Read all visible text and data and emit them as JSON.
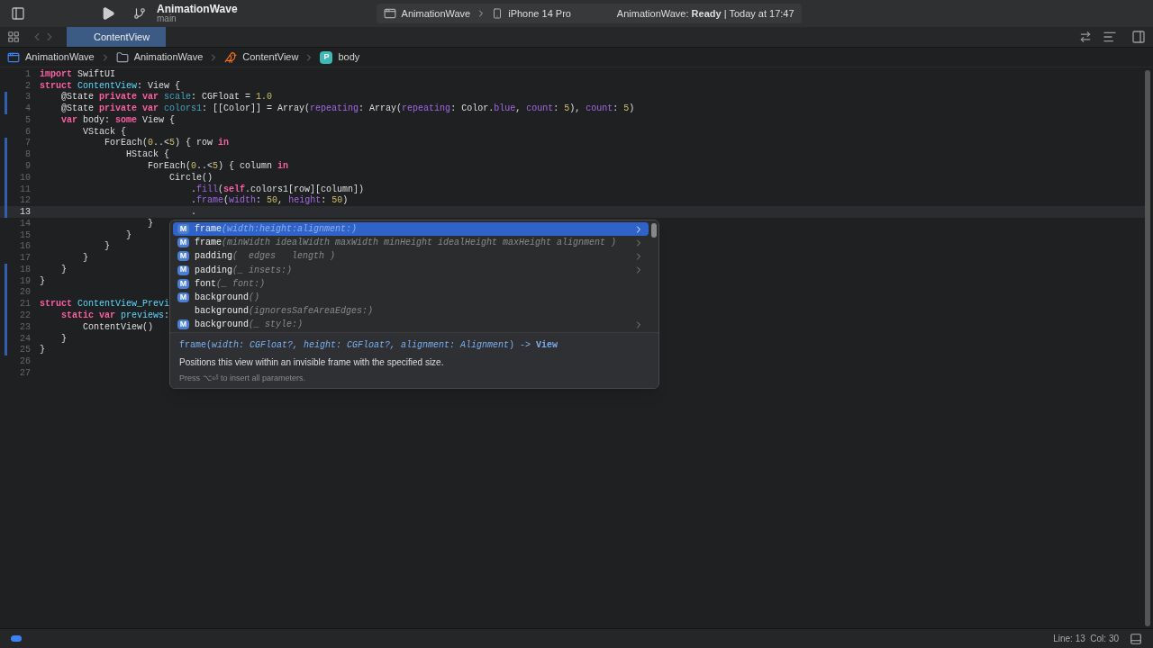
{
  "toolbar": {
    "project": "AnimationWave",
    "branch": "main",
    "scheme": "AnimationWave",
    "device": "iPhone 14 Pro",
    "status": "AnimationWave: **Ready** | Today at 17:47"
  },
  "tabs": [
    {
      "label": "ContentView",
      "selected": true
    }
  ],
  "breadcrumbs": [
    {
      "label": "AnimationWave",
      "kind": "app"
    },
    {
      "label": "AnimationWave",
      "kind": "folder"
    },
    {
      "label": "ContentView",
      "kind": "swift"
    },
    {
      "label": "body",
      "kind": "property",
      "badge": "P"
    }
  ],
  "editor": {
    "lines": [
      {
        "number": "1",
        "changed": false,
        "current": false,
        "tokens": [
          {
            "text": "import",
            "kind": "keyword"
          },
          {
            "text": " SwiftUI",
            "kind": "plain"
          }
        ]
      },
      {
        "number": "2",
        "changed": false,
        "current": false,
        "tokens": [
          {
            "text": "struct",
            "kind": "keyword"
          },
          {
            "text": " ContentView",
            "kind": "declaration"
          },
          {
            "text": ": View {",
            "kind": "plain"
          }
        ]
      },
      {
        "number": "3",
        "changed": true,
        "current": false,
        "tokens": [
          {
            "text": "    @State ",
            "kind": "plain"
          },
          {
            "text": "private var",
            "kind": "keyword"
          },
          {
            "text": " scale",
            "kind": "variable"
          },
          {
            "text": ": CGFloat = ",
            "kind": "plain"
          },
          {
            "text": "1.0",
            "kind": "number"
          }
        ]
      },
      {
        "number": "4",
        "changed": true,
        "current": false,
        "tokens": [
          {
            "text": "    @State ",
            "kind": "plain"
          },
          {
            "text": "private var",
            "kind": "keyword"
          },
          {
            "text": " colors1",
            "kind": "variable"
          },
          {
            "text": ": [[Color]] = Array(",
            "kind": "plain"
          },
          {
            "text": "repeating",
            "kind": "parameter"
          },
          {
            "text": ": Array(",
            "kind": "plain"
          },
          {
            "text": "repeating",
            "kind": "parameter"
          },
          {
            "text": ": Color.",
            "kind": "plain"
          },
          {
            "text": "blue",
            "kind": "method"
          },
          {
            "text": ", ",
            "kind": "plain"
          },
          {
            "text": "count",
            "kind": "parameter"
          },
          {
            "text": ": ",
            "kind": "plain"
          },
          {
            "text": "5",
            "kind": "number"
          },
          {
            "text": "), ",
            "kind": "plain"
          },
          {
            "text": "count",
            "kind": "parameter"
          },
          {
            "text": ": ",
            "kind": "plain"
          },
          {
            "text": "5",
            "kind": "number"
          },
          {
            "text": ")",
            "kind": "plain"
          }
        ]
      },
      {
        "number": "5",
        "changed": false,
        "current": false,
        "tokens": [
          {
            "text": "    var",
            "kind": "keyword"
          },
          {
            "text": " body: ",
            "kind": "plain"
          },
          {
            "text": "some",
            "kind": "keyword"
          },
          {
            "text": " View {",
            "kind": "plain"
          }
        ]
      },
      {
        "number": "6",
        "changed": false,
        "current": false,
        "tokens": [
          {
            "text": "        VStack {",
            "kind": "plain"
          }
        ]
      },
      {
        "number": "7",
        "changed": true,
        "current": false,
        "tokens": [
          {
            "text": "            ForEach(",
            "kind": "plain"
          },
          {
            "text": "0",
            "kind": "number"
          },
          {
            "text": "..<",
            "kind": "plain"
          },
          {
            "text": "5",
            "kind": "number"
          },
          {
            "text": ") { row ",
            "kind": "plain"
          },
          {
            "text": "in",
            "kind": "keyword"
          }
        ]
      },
      {
        "number": "8",
        "changed": true,
        "current": false,
        "tokens": [
          {
            "text": "                HStack {",
            "kind": "plain"
          }
        ]
      },
      {
        "number": "9",
        "changed": true,
        "current": false,
        "tokens": [
          {
            "text": "                    ForEach(",
            "kind": "plain"
          },
          {
            "text": "0",
            "kind": "number"
          },
          {
            "text": "..<",
            "kind": "plain"
          },
          {
            "text": "5",
            "kind": "number"
          },
          {
            "text": ") { column ",
            "kind": "plain"
          },
          {
            "text": "in",
            "kind": "keyword"
          }
        ]
      },
      {
        "number": "10",
        "changed": true,
        "current": false,
        "tokens": [
          {
            "text": "                        Circle()",
            "kind": "plain"
          }
        ]
      },
      {
        "number": "11",
        "changed": true,
        "current": false,
        "tokens": [
          {
            "text": "                            .",
            "kind": "plain"
          },
          {
            "text": "fill",
            "kind": "method"
          },
          {
            "text": "(",
            "kind": "plain"
          },
          {
            "text": "self",
            "kind": "keyword"
          },
          {
            "text": ".colors1[row][column])",
            "kind": "plain"
          }
        ]
      },
      {
        "number": "12",
        "changed": true,
        "current": false,
        "tokens": [
          {
            "text": "                            .",
            "kind": "plain"
          },
          {
            "text": "frame",
            "kind": "method"
          },
          {
            "text": "(",
            "kind": "plain"
          },
          {
            "text": "width",
            "kind": "parameter"
          },
          {
            "text": ": ",
            "kind": "plain"
          },
          {
            "text": "50",
            "kind": "number"
          },
          {
            "text": ", ",
            "kind": "plain"
          },
          {
            "text": "height",
            "kind": "parameter"
          },
          {
            "text": ": ",
            "kind": "plain"
          },
          {
            "text": "50",
            "kind": "number"
          },
          {
            "text": ")",
            "kind": "plain"
          }
        ]
      },
      {
        "number": "13",
        "changed": true,
        "current": true,
        "tokens": [
          {
            "text": "                            .",
            "kind": "plain"
          }
        ]
      },
      {
        "number": "14",
        "changed": false,
        "current": false,
        "tokens": [
          {
            "text": "                    }",
            "kind": "plain"
          }
        ]
      },
      {
        "number": "15",
        "changed": false,
        "current": false,
        "tokens": [
          {
            "text": "                }",
            "kind": "plain"
          }
        ]
      },
      {
        "number": "16",
        "changed": false,
        "current": false,
        "tokens": [
          {
            "text": "            }",
            "kind": "plain"
          }
        ]
      },
      {
        "number": "17",
        "changed": false,
        "current": false,
        "tokens": [
          {
            "text": "        }",
            "kind": "plain"
          }
        ]
      },
      {
        "number": "18",
        "changed": true,
        "current": false,
        "tokens": [
          {
            "text": "    }",
            "kind": "plain"
          }
        ]
      },
      {
        "number": "19",
        "changed": true,
        "current": false,
        "tokens": [
          {
            "text": "}",
            "kind": "plain"
          }
        ]
      },
      {
        "number": "20",
        "changed": true,
        "current": false
      },
      {
        "number": "21",
        "changed": true,
        "current": false,
        "tokens": [
          {
            "text": "struct",
            "kind": "keyword"
          },
          {
            "text": " ContentView_Previ",
            "kind": "declaration"
          }
        ]
      },
      {
        "number": "22",
        "changed": true,
        "current": false,
        "tokens": [
          {
            "text": "    static var",
            "kind": "keyword"
          },
          {
            "text": " previews",
            "kind": "declaration"
          },
          {
            "text": ":",
            "kind": "plain"
          }
        ]
      },
      {
        "number": "23",
        "changed": true,
        "current": false,
        "tokens": [
          {
            "text": "        ContentView()",
            "kind": "plain"
          }
        ]
      },
      {
        "number": "24",
        "changed": true,
        "current": false,
        "tokens": [
          {
            "text": "    }",
            "kind": "plain"
          }
        ]
      },
      {
        "number": "25",
        "changed": true,
        "current": false,
        "tokens": [
          {
            "text": "}",
            "kind": "plain"
          }
        ]
      },
      {
        "number": "26",
        "changed": false,
        "current": false
      },
      {
        "number": "27",
        "changed": false,
        "current": false
      }
    ]
  },
  "completion": {
    "items": [
      {
        "badge": "M",
        "name": "frame",
        "params": "(width:height:alignment:)",
        "has_more": true,
        "selected": true
      },
      {
        "badge": "M",
        "name": "frame",
        "params": "(minWidth idealWidth maxWidth minHeight idealHeight maxHeight alignment )",
        "has_more": true,
        "selected": false
      },
      {
        "badge": "M",
        "name": "padding",
        "params": "(  edges   length )",
        "has_more": true,
        "selected": false
      },
      {
        "badge": "M",
        "name": "padding",
        "params": "(_ insets:)",
        "has_more": true,
        "selected": false
      },
      {
        "badge": "M",
        "name": "font",
        "params": "(_ font:)",
        "has_more": false,
        "selected": false
      },
      {
        "badge": "M",
        "name": "background",
        "params": "()",
        "has_more": false,
        "selected": false
      },
      {
        "name": "background",
        "params": "(ignoresSafeAreaEdges:)",
        "has_more": false,
        "selected": false
      },
      {
        "badge": "M",
        "name": "background",
        "params": "(_ style:)",
        "has_more": true,
        "selected": false
      }
    ],
    "signature": "frame(*width: CGFloat?, height: CGFloat?, alignment: Alignment*) -> **View**",
    "description": "Positions this view within an invisible frame with the specified size.",
    "hint": "Press ⌥⏎ to insert all parameters."
  },
  "status_bar": {
    "position": "Line: 13  Col: 30"
  }
}
